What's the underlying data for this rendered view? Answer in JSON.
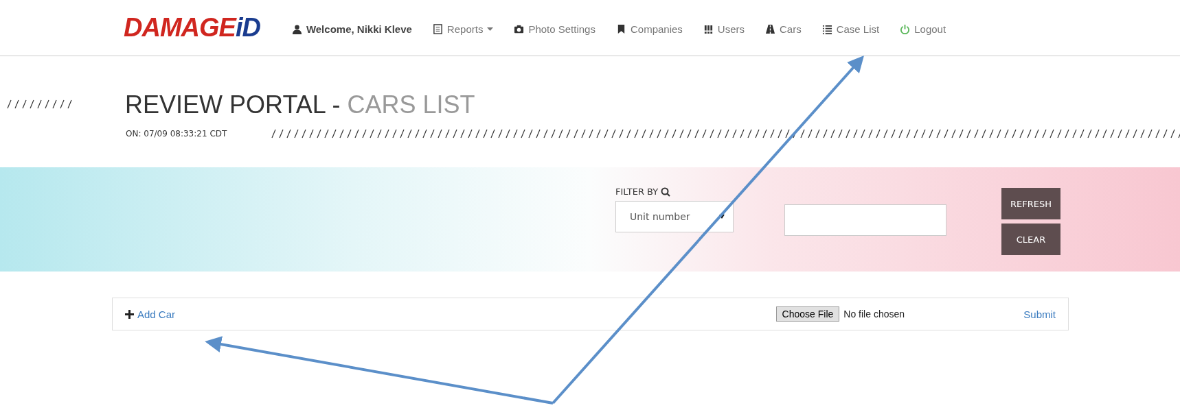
{
  "header": {
    "logo": {
      "main": "DAMAGE",
      "accent": "iD"
    },
    "nav": [
      {
        "kind": "user",
        "label": "Welcome, Nikki Kleve",
        "dropdown": false
      },
      {
        "kind": "report",
        "label": "Reports",
        "dropdown": true
      },
      {
        "kind": "camera",
        "label": "Photo Settings",
        "dropdown": false
      },
      {
        "kind": "bookmark",
        "label": "Companies",
        "dropdown": false
      },
      {
        "kind": "users",
        "label": "Users",
        "dropdown": false
      },
      {
        "kind": "road",
        "label": "Cars",
        "dropdown": false
      },
      {
        "kind": "list",
        "label": "Case List",
        "dropdown": false
      },
      {
        "kind": "power",
        "label": "Logout",
        "dropdown": false
      }
    ]
  },
  "title": {
    "main": "REVIEW PORTAL - ",
    "sub": "CARS LIST",
    "timestamp": "ON: 07/09 08:33:21 CDT"
  },
  "filter": {
    "label": "FILTER BY",
    "select_value": "Unit number",
    "buttons": [
      "REFRESH",
      "CLEAR"
    ]
  },
  "add_panel": {
    "add_label": "Add Car",
    "file_button": "Choose File",
    "file_status": "No file chosen",
    "submit": "Submit"
  }
}
